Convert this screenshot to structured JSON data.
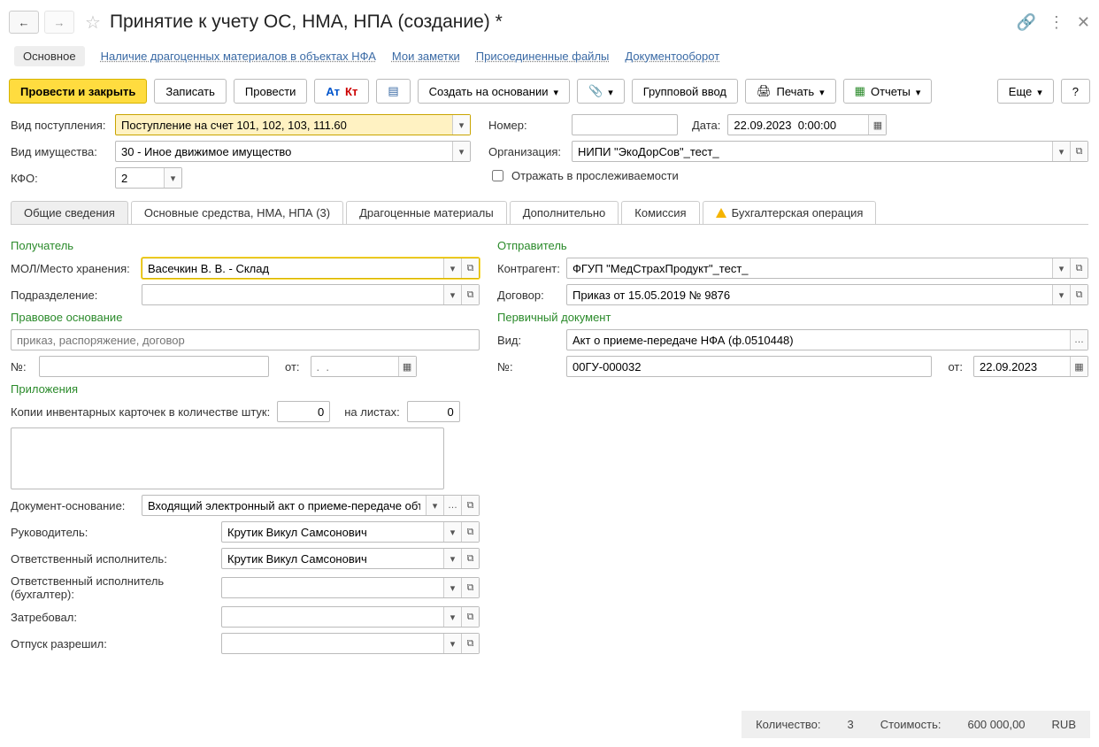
{
  "title": "Принятие к учету ОС, НМА, НПА (создание) *",
  "subnav": {
    "active": "Основное",
    "links": [
      "Наличие драгоценных материалов в объектах НФА",
      "Мои заметки",
      "Присоединенные файлы",
      "Документооборот"
    ]
  },
  "toolbar": {
    "post_close": "Провести и закрыть",
    "save": "Записать",
    "post": "Провести",
    "create_based": "Создать на основании",
    "group_input": "Групповой ввод",
    "print": "Печать",
    "reports": "Отчеты",
    "more": "Еще",
    "help": "?"
  },
  "header": {
    "receipt_type_label": "Вид поступления:",
    "receipt_type_value": "Поступление на счет 101, 102, 103, 111.60",
    "property_type_label": "Вид имущества:",
    "property_type_value": "30 - Иное движимое имущество",
    "kfo_label": "КФО:",
    "kfo_value": "2",
    "number_label": "Номер:",
    "number_value": "",
    "date_label": "Дата:",
    "date_value": "22.09.2023  0:00:00",
    "org_label": "Организация:",
    "org_value": "НИПИ \"ЭкоДорСов\"_тест_",
    "trace_label": "Отражать в прослеживаемости"
  },
  "tabs": [
    "Общие сведения",
    "Основные средства, НМА, НПА (3)",
    "Драгоценные материалы",
    "Дополнительно",
    "Комиссия",
    "Бухгалтерская операция"
  ],
  "general": {
    "receiver_title": "Получатель",
    "mol_label": "МОЛ/Место хранения:",
    "mol_value": "Васечкин В. В. - Склад",
    "dept_label": "Подразделение:",
    "dept_value": "",
    "legal_title": "Правовое основание",
    "legal_placeholder": "приказ, распоряжение, договор",
    "num_label": "№:",
    "from_label": "от:",
    "from_placeholder": ".  .",
    "attachments_title": "Приложения",
    "copies_label": "Копии инвентарных карточек в количестве штук:",
    "copies_value": "0",
    "sheets_label": "на листах:",
    "sheets_value": "0",
    "docbase_label": "Документ-основание:",
    "docbase_value": "Входящий электронный акт о приеме-передаче объе",
    "head_label": "Руководитель:",
    "head_value": "Крутик Викул Самсонович",
    "resp_label": "Ответственный исполнитель:",
    "resp_value": "Крутик Викул Самсонович",
    "resp_acct_label": "Ответственный исполнитель (бухгалтер):",
    "required_label": "Затребовал:",
    "release_label": "Отпуск разрешил:",
    "sender_title": "Отправитель",
    "counterparty_label": "Контрагент:",
    "counterparty_value": "ФГУП \"МедСтрахПродукт\"_тест_",
    "contract_label": "Договор:",
    "contract_value": "Приказ от 15.05.2019 № 9876",
    "primary_title": "Первичный документ",
    "kind_label": "Вид:",
    "kind_value": "Акт о приеме-передаче НФА (ф.0510448)",
    "pnum_label": "№:",
    "pnum_value": "00ГУ-000032",
    "pfrom_label": "от:",
    "pfrom_value": "22.09.2023"
  },
  "status": {
    "qty_label": "Количество:",
    "qty_value": "3",
    "cost_label": "Стоимость:",
    "cost_value": "600 000,00",
    "currency": "RUB"
  }
}
